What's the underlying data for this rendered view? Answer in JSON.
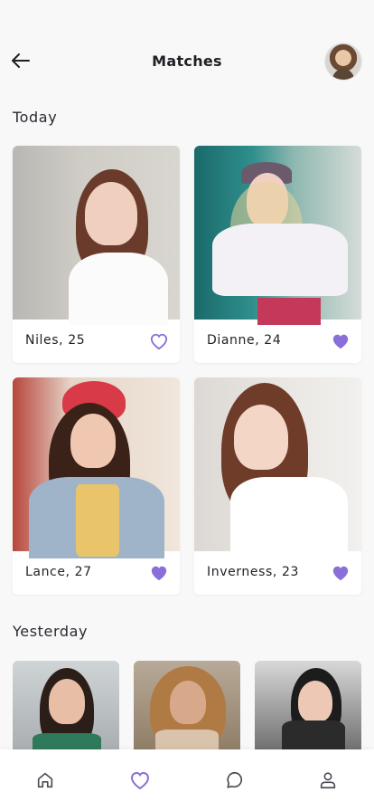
{
  "header": {
    "title": "Matches",
    "back_icon": "arrow-left-icon",
    "avatar": "profile-avatar"
  },
  "sections": {
    "today": "Today",
    "yesterday": "Yesterday"
  },
  "accent_color": "#8b6fd9",
  "matches_today": [
    {
      "name": "Niles, 25",
      "liked": false
    },
    {
      "name": "Dianne, 24",
      "liked": true
    },
    {
      "name": "Lance, 27",
      "liked": true
    },
    {
      "name": "Inverness, 23",
      "liked": true
    }
  ],
  "matches_yesterday_count_visible": 3,
  "bottom_nav": [
    {
      "icon": "home-icon",
      "active": false
    },
    {
      "icon": "heart-icon",
      "active": true
    },
    {
      "icon": "chat-icon",
      "active": false
    },
    {
      "icon": "profile-icon",
      "active": false
    }
  ]
}
